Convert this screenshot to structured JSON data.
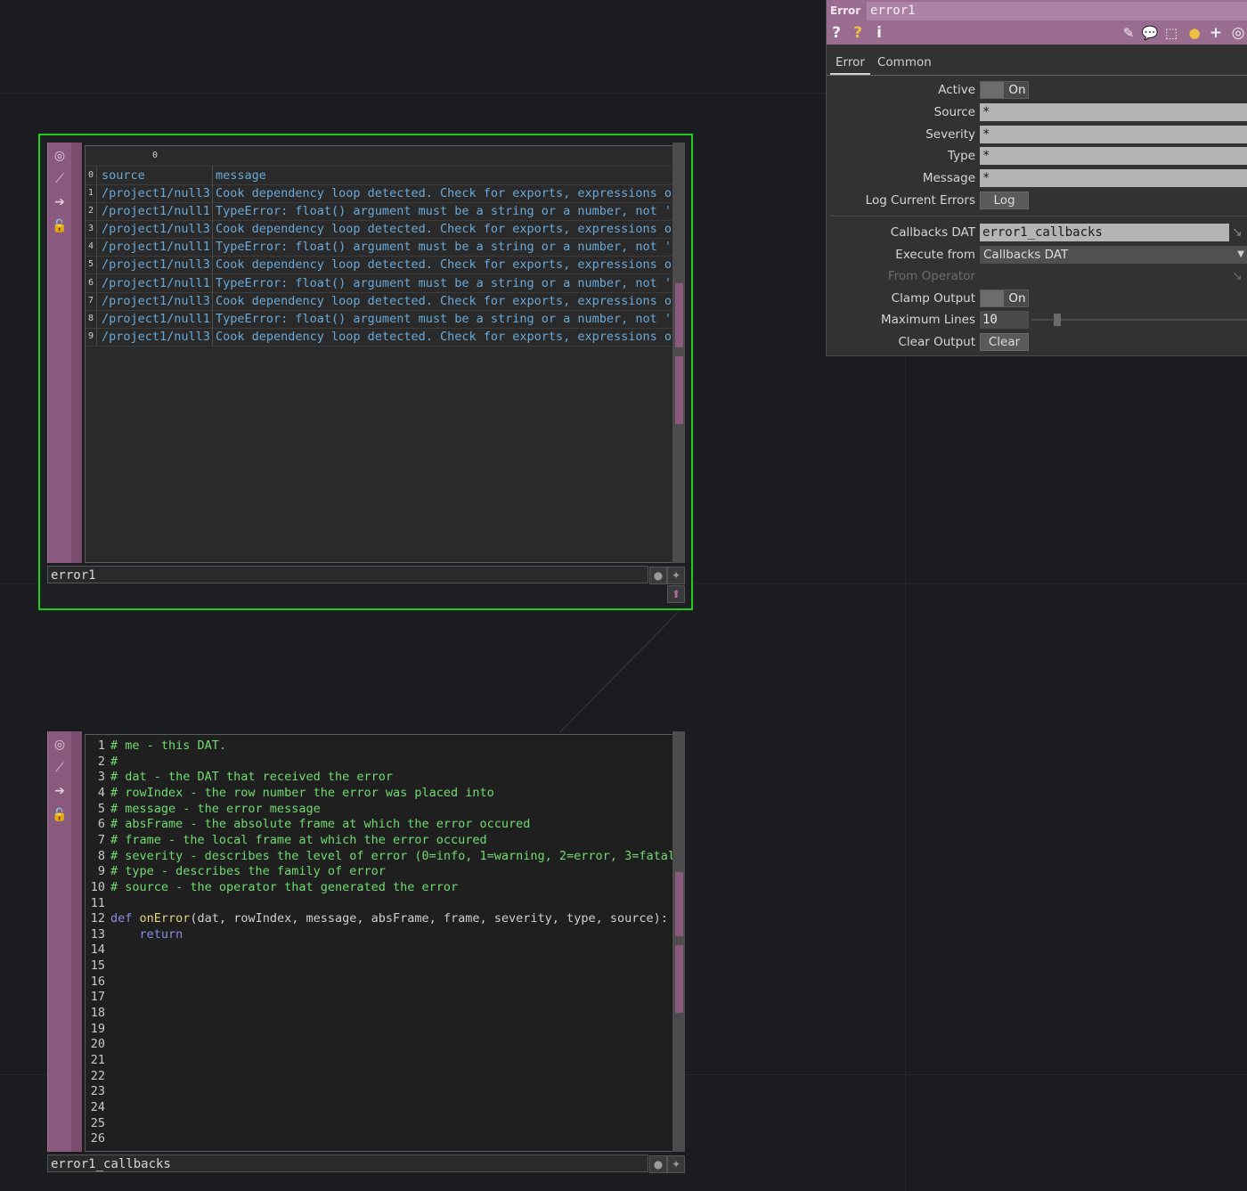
{
  "table_dat": {
    "name": "error1",
    "column_header_index": "0",
    "header": {
      "index": "0",
      "source": "source",
      "message": "message"
    },
    "rows": [
      {
        "index": "1",
        "source": "/project1/null3",
        "message": "Cook dependency loop detected. Check for exports, expressions o"
      },
      {
        "index": "2",
        "source": "/project1/null1",
        "message": "TypeError: float() argument must be a string or a number, not '"
      },
      {
        "index": "3",
        "source": "/project1/null3",
        "message": "Cook dependency loop detected. Check for exports, expressions o"
      },
      {
        "index": "4",
        "source": "/project1/null1",
        "message": "TypeError: float() argument must be a string or a number, not '"
      },
      {
        "index": "5",
        "source": "/project1/null3",
        "message": "Cook dependency loop detected. Check for exports, expressions o"
      },
      {
        "index": "6",
        "source": "/project1/null1",
        "message": "TypeError: float() argument must be a string or a number, not '"
      },
      {
        "index": "7",
        "source": "/project1/null3",
        "message": "Cook dependency loop detected. Check for exports, expressions o"
      },
      {
        "index": "8",
        "source": "/project1/null1",
        "message": "TypeError: float() argument must be a string or a number, not '"
      },
      {
        "index": "9",
        "source": "/project1/null3",
        "message": "Cook dependency loop detected. Check for exports, expressions o"
      }
    ]
  },
  "code_dat": {
    "name": "error1_callbacks",
    "lines": [
      {
        "n": "1",
        "parts": [
          {
            "c": "cm",
            "t": "# me - this DAT."
          }
        ]
      },
      {
        "n": "2",
        "parts": [
          {
            "c": "cm",
            "t": "#"
          }
        ]
      },
      {
        "n": "3",
        "parts": [
          {
            "c": "cm",
            "t": "# dat - the DAT that received the error"
          }
        ]
      },
      {
        "n": "4",
        "parts": [
          {
            "c": "cm",
            "t": "# rowIndex - the row number the error was placed into"
          }
        ]
      },
      {
        "n": "5",
        "parts": [
          {
            "c": "cm",
            "t": "# message - the error message"
          }
        ]
      },
      {
        "n": "6",
        "parts": [
          {
            "c": "cm",
            "t": "# absFrame - the absolute frame at which the error occured"
          }
        ]
      },
      {
        "n": "7",
        "parts": [
          {
            "c": "cm",
            "t": "# frame - the local frame at which the error occured"
          }
        ]
      },
      {
        "n": "8",
        "parts": [
          {
            "c": "cm",
            "t": "# severity - describes the level of error (0=info, 1=warning, 2=error, 3=fatal"
          }
        ]
      },
      {
        "n": "9",
        "parts": [
          {
            "c": "cm",
            "t": "# type - describes the family of error"
          }
        ]
      },
      {
        "n": "10",
        "parts": [
          {
            "c": "cm",
            "t": "# source - the operator that generated the error"
          }
        ]
      },
      {
        "n": "11",
        "parts": []
      },
      {
        "n": "12",
        "parts": [
          {
            "c": "kw",
            "t": "def "
          },
          {
            "c": "fn",
            "t": "onError"
          },
          {
            "c": "tx",
            "t": "(dat, rowIndex, message, absFrame, frame, severity, type, source):"
          }
        ]
      },
      {
        "n": "13",
        "parts": [
          {
            "c": "kw",
            "t": "    return"
          }
        ]
      },
      {
        "n": "14",
        "parts": []
      },
      {
        "n": "15",
        "parts": []
      },
      {
        "n": "16",
        "parts": []
      },
      {
        "n": "17",
        "parts": []
      },
      {
        "n": "18",
        "parts": []
      },
      {
        "n": "19",
        "parts": []
      },
      {
        "n": "20",
        "parts": []
      },
      {
        "n": "21",
        "parts": []
      },
      {
        "n": "22",
        "parts": []
      },
      {
        "n": "23",
        "parts": []
      },
      {
        "n": "24",
        "parts": []
      },
      {
        "n": "25",
        "parts": []
      },
      {
        "n": "26",
        "parts": []
      }
    ]
  },
  "panel": {
    "op_type": "Error",
    "op_name": "error1",
    "tools_left": [
      "?",
      "?",
      "i"
    ],
    "tools_right": [
      "pencil-icon",
      "comment-icon",
      "clone-icon",
      "python-icon",
      "plus-icon",
      "target-icon"
    ],
    "tabs": [
      "Error",
      "Common"
    ],
    "active_tab": "Error",
    "params": {
      "active": {
        "label": "Active",
        "value": "On"
      },
      "source": {
        "label": "Source",
        "value": "*"
      },
      "severity": {
        "label": "Severity",
        "value": "*"
      },
      "type": {
        "label": "Type",
        "value": "*"
      },
      "message": {
        "label": "Message",
        "value": "*"
      },
      "log_current_errors": {
        "label": "Log Current Errors",
        "button": "Log"
      },
      "callbacks_dat": {
        "label": "Callbacks DAT",
        "value": "error1_callbacks"
      },
      "execute_from": {
        "label": "Execute from",
        "value": "Callbacks DAT"
      },
      "from_operator": {
        "label": "From Operator",
        "value": ""
      },
      "clamp_output": {
        "label": "Clamp Output",
        "value": "On"
      },
      "maximum_lines": {
        "label": "Maximum Lines",
        "value": "10"
      },
      "clear_output": {
        "label": "Clear Output",
        "button": "Clear"
      }
    }
  },
  "colors": {
    "selection": "#1ecc1e",
    "dat_purple": "#8a5a7e",
    "panel_header": "#9a6d90",
    "background": "#1b1c1f"
  }
}
